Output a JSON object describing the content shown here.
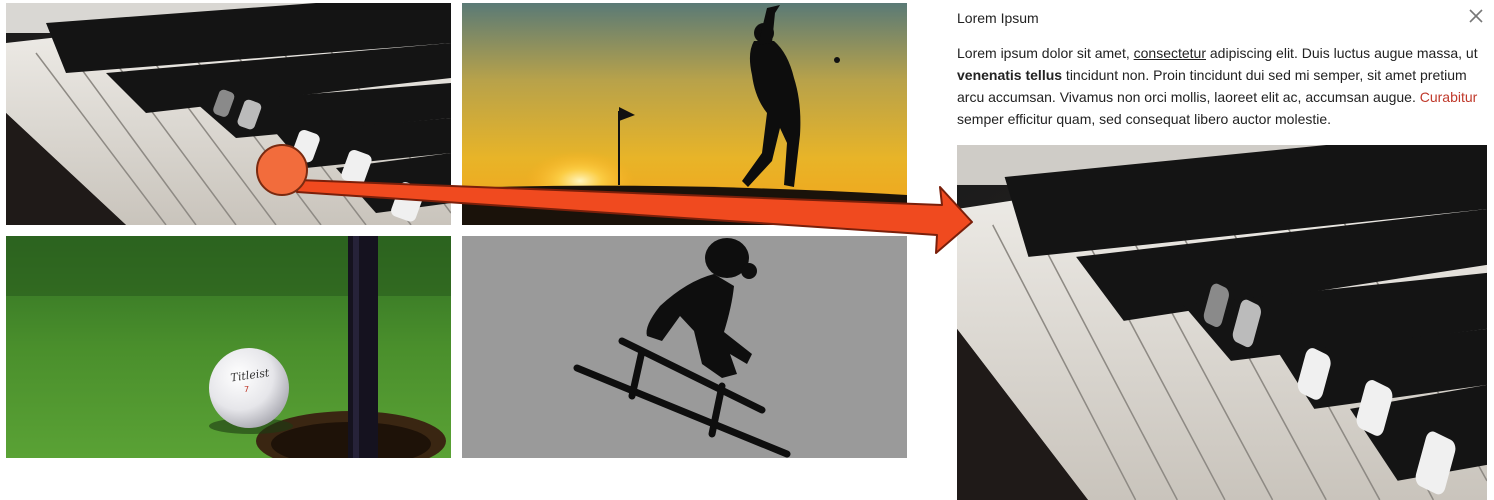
{
  "panel": {
    "title": "Lorem Ipsum",
    "paragraph": {
      "t1": "Lorem ipsum dolor sit amet, ",
      "link_underlined": "consectetur",
      "t2": " adipiscing elit. Duis luctus augue massa, ut ",
      "bold": "venenatis tellus",
      "t3": " tincidunt non. Proin tincidunt dui sed mi semper, sit amet pretium arcu accumsan. Vivamus non orci mollis, laoreet elit ac, accumsan augue. ",
      "link_red": "Curabitur",
      "t4": " semper efficitur quam, sed consequat libero auctor molestie."
    },
    "close_icon": "close-icon"
  },
  "gallery": {
    "tiles": [
      {
        "name": "piano-keys"
      },
      {
        "name": "golfer-sunset"
      },
      {
        "name": "golf-ball-hole"
      },
      {
        "name": "sledder-silhouette"
      }
    ]
  },
  "colors": {
    "accent_link": "#c0392b",
    "drag_handle": "#f26c3c",
    "drag_arrow": "#f04a1f"
  }
}
